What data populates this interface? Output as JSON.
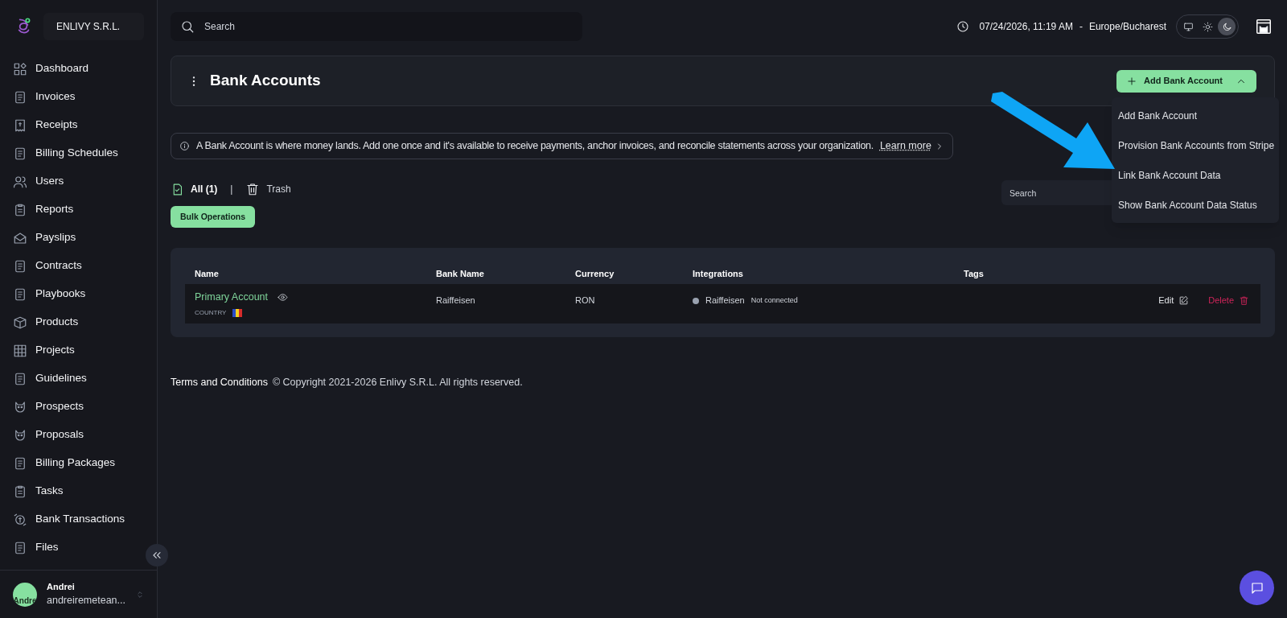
{
  "sidebar": {
    "company": "ENLIVY S.R.L.",
    "items": [
      {
        "label": "Dashboard"
      },
      {
        "label": "Invoices"
      },
      {
        "label": "Receipts"
      },
      {
        "label": "Billing Schedules"
      },
      {
        "label": "Users"
      },
      {
        "label": "Reports"
      },
      {
        "label": "Payslips"
      },
      {
        "label": "Contracts"
      },
      {
        "label": "Playbooks"
      },
      {
        "label": "Products"
      },
      {
        "label": "Projects"
      },
      {
        "label": "Guidelines"
      },
      {
        "label": "Prospects"
      },
      {
        "label": "Proposals"
      },
      {
        "label": "Billing Packages"
      },
      {
        "label": "Tasks"
      },
      {
        "label": "Bank Transactions"
      },
      {
        "label": "Files"
      }
    ],
    "user": {
      "name": "Andrei",
      "avatar_text": "Andre",
      "email": "andreiremetean..."
    }
  },
  "topbar": {
    "search_placeholder": "Search",
    "datetime": "07/24/2026, 11:19 AM",
    "separator": "-",
    "timezone": "Europe/Bucharest",
    "theme_modes": [
      {
        "kind": "system",
        "selected": false
      },
      {
        "kind": "light",
        "selected": false
      },
      {
        "kind": "dark",
        "selected": true
      }
    ]
  },
  "header": {
    "title": "Bank Accounts",
    "add_button": "Add Bank Account",
    "menu_open": true,
    "menu": [
      "Add Bank Account",
      "Provision Bank Accounts from Stripe",
      "Link Bank Account Data",
      "Show Bank Account Data Status"
    ]
  },
  "info": {
    "text": "A Bank Account is where money lands. Add one once and it's available to receive payments, anchor invoices, and reconcile statements across your organization.",
    "link": "Learn more"
  },
  "tab_divider": "|",
  "tabs": [
    {
      "label": "All (1)",
      "kind": "all",
      "selected": true
    },
    {
      "label": "Trash",
      "kind": "trash",
      "selected": false
    }
  ],
  "bulk_button": "Bulk Operations",
  "list_search_placeholder": "Search",
  "table": {
    "columns": [
      "Name",
      "Bank Name",
      "Currency",
      "Integrations",
      "Tags"
    ],
    "rows": [
      {
        "name": "Primary Account",
        "country_label": "COUNTRY",
        "bank": "Raiffeisen",
        "currency": "RON",
        "integration": "Raiffeisen",
        "integration_status": "Not connected",
        "edit": "Edit",
        "delete": "Delete"
      }
    ]
  },
  "footer": {
    "link": "Terms and Conditions",
    "copyright": "© Copyright 2021-2026 Enlivy S.R.L. All rights reserved."
  }
}
